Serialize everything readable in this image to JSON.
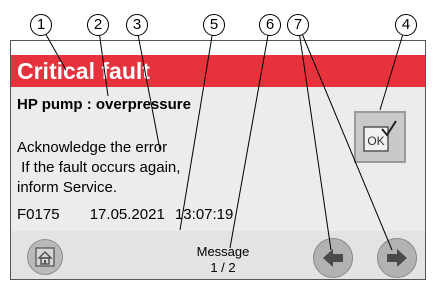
{
  "screen": {
    "header": {
      "title": "Critical fault"
    },
    "fault": {
      "name": "HP pump : overpressure",
      "message_lines": [
        "Acknowledge the error",
        " If the fault occurs again,",
        "inform Service."
      ],
      "code": "F0175",
      "date": "17.05.2021",
      "time": "13:07:19"
    },
    "pager": {
      "label": "Message",
      "page": "1 / 2"
    },
    "colors": {
      "header_bg": "#e6323c",
      "panel_bg": "#ececec"
    },
    "icons": {
      "home": "home-icon",
      "ok": "ok-acknowledge-icon",
      "prev": "arrow-left-icon",
      "next": "arrow-right-icon"
    }
  },
  "callouts": [
    "1",
    "2",
    "3",
    "4",
    "5",
    "6",
    "7"
  ]
}
